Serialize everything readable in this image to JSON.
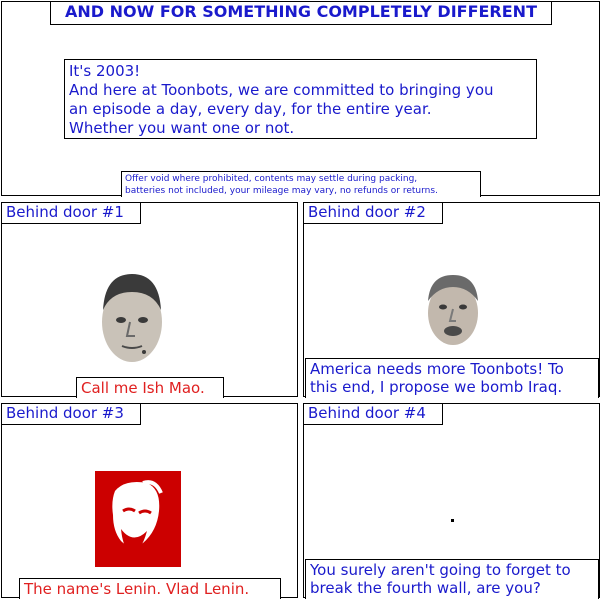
{
  "header": {
    "title": "AND NOW FOR SOMETHING COMPLETELY DIFFERENT",
    "intro": "It's 2003!\nAnd here at Toonbots, we are committed to bringing you\nan episode a day, every day, for the entire year.\nWhether you want one or not.",
    "fine_print": "Offer void where prohibited, contents may settle during packing,\nbatteries not included, your mileage may vary, no refunds or returns."
  },
  "panels": [
    {
      "door": "Behind door #1",
      "caption": "Call me Ish Mao.",
      "caption_color": "#e02020"
    },
    {
      "door": "Behind door #2",
      "caption": "America needs more Toonbots!  To\nthis end, I propose we bomb Iraq.",
      "caption_color": "#1a1acc"
    },
    {
      "door": "Behind door #3",
      "caption": "The name's Lenin.  Vlad Lenin.",
      "caption_color": "#e02020"
    },
    {
      "door": "Behind door #4",
      "caption": "You surely aren't going to forget to\nbreak the fourth wall, are you?",
      "caption_color": "#1a1acc"
    }
  ],
  "colors": {
    "text_blue": "#1a1acc",
    "text_red": "#e02020",
    "poster_red": "#cc0000"
  }
}
